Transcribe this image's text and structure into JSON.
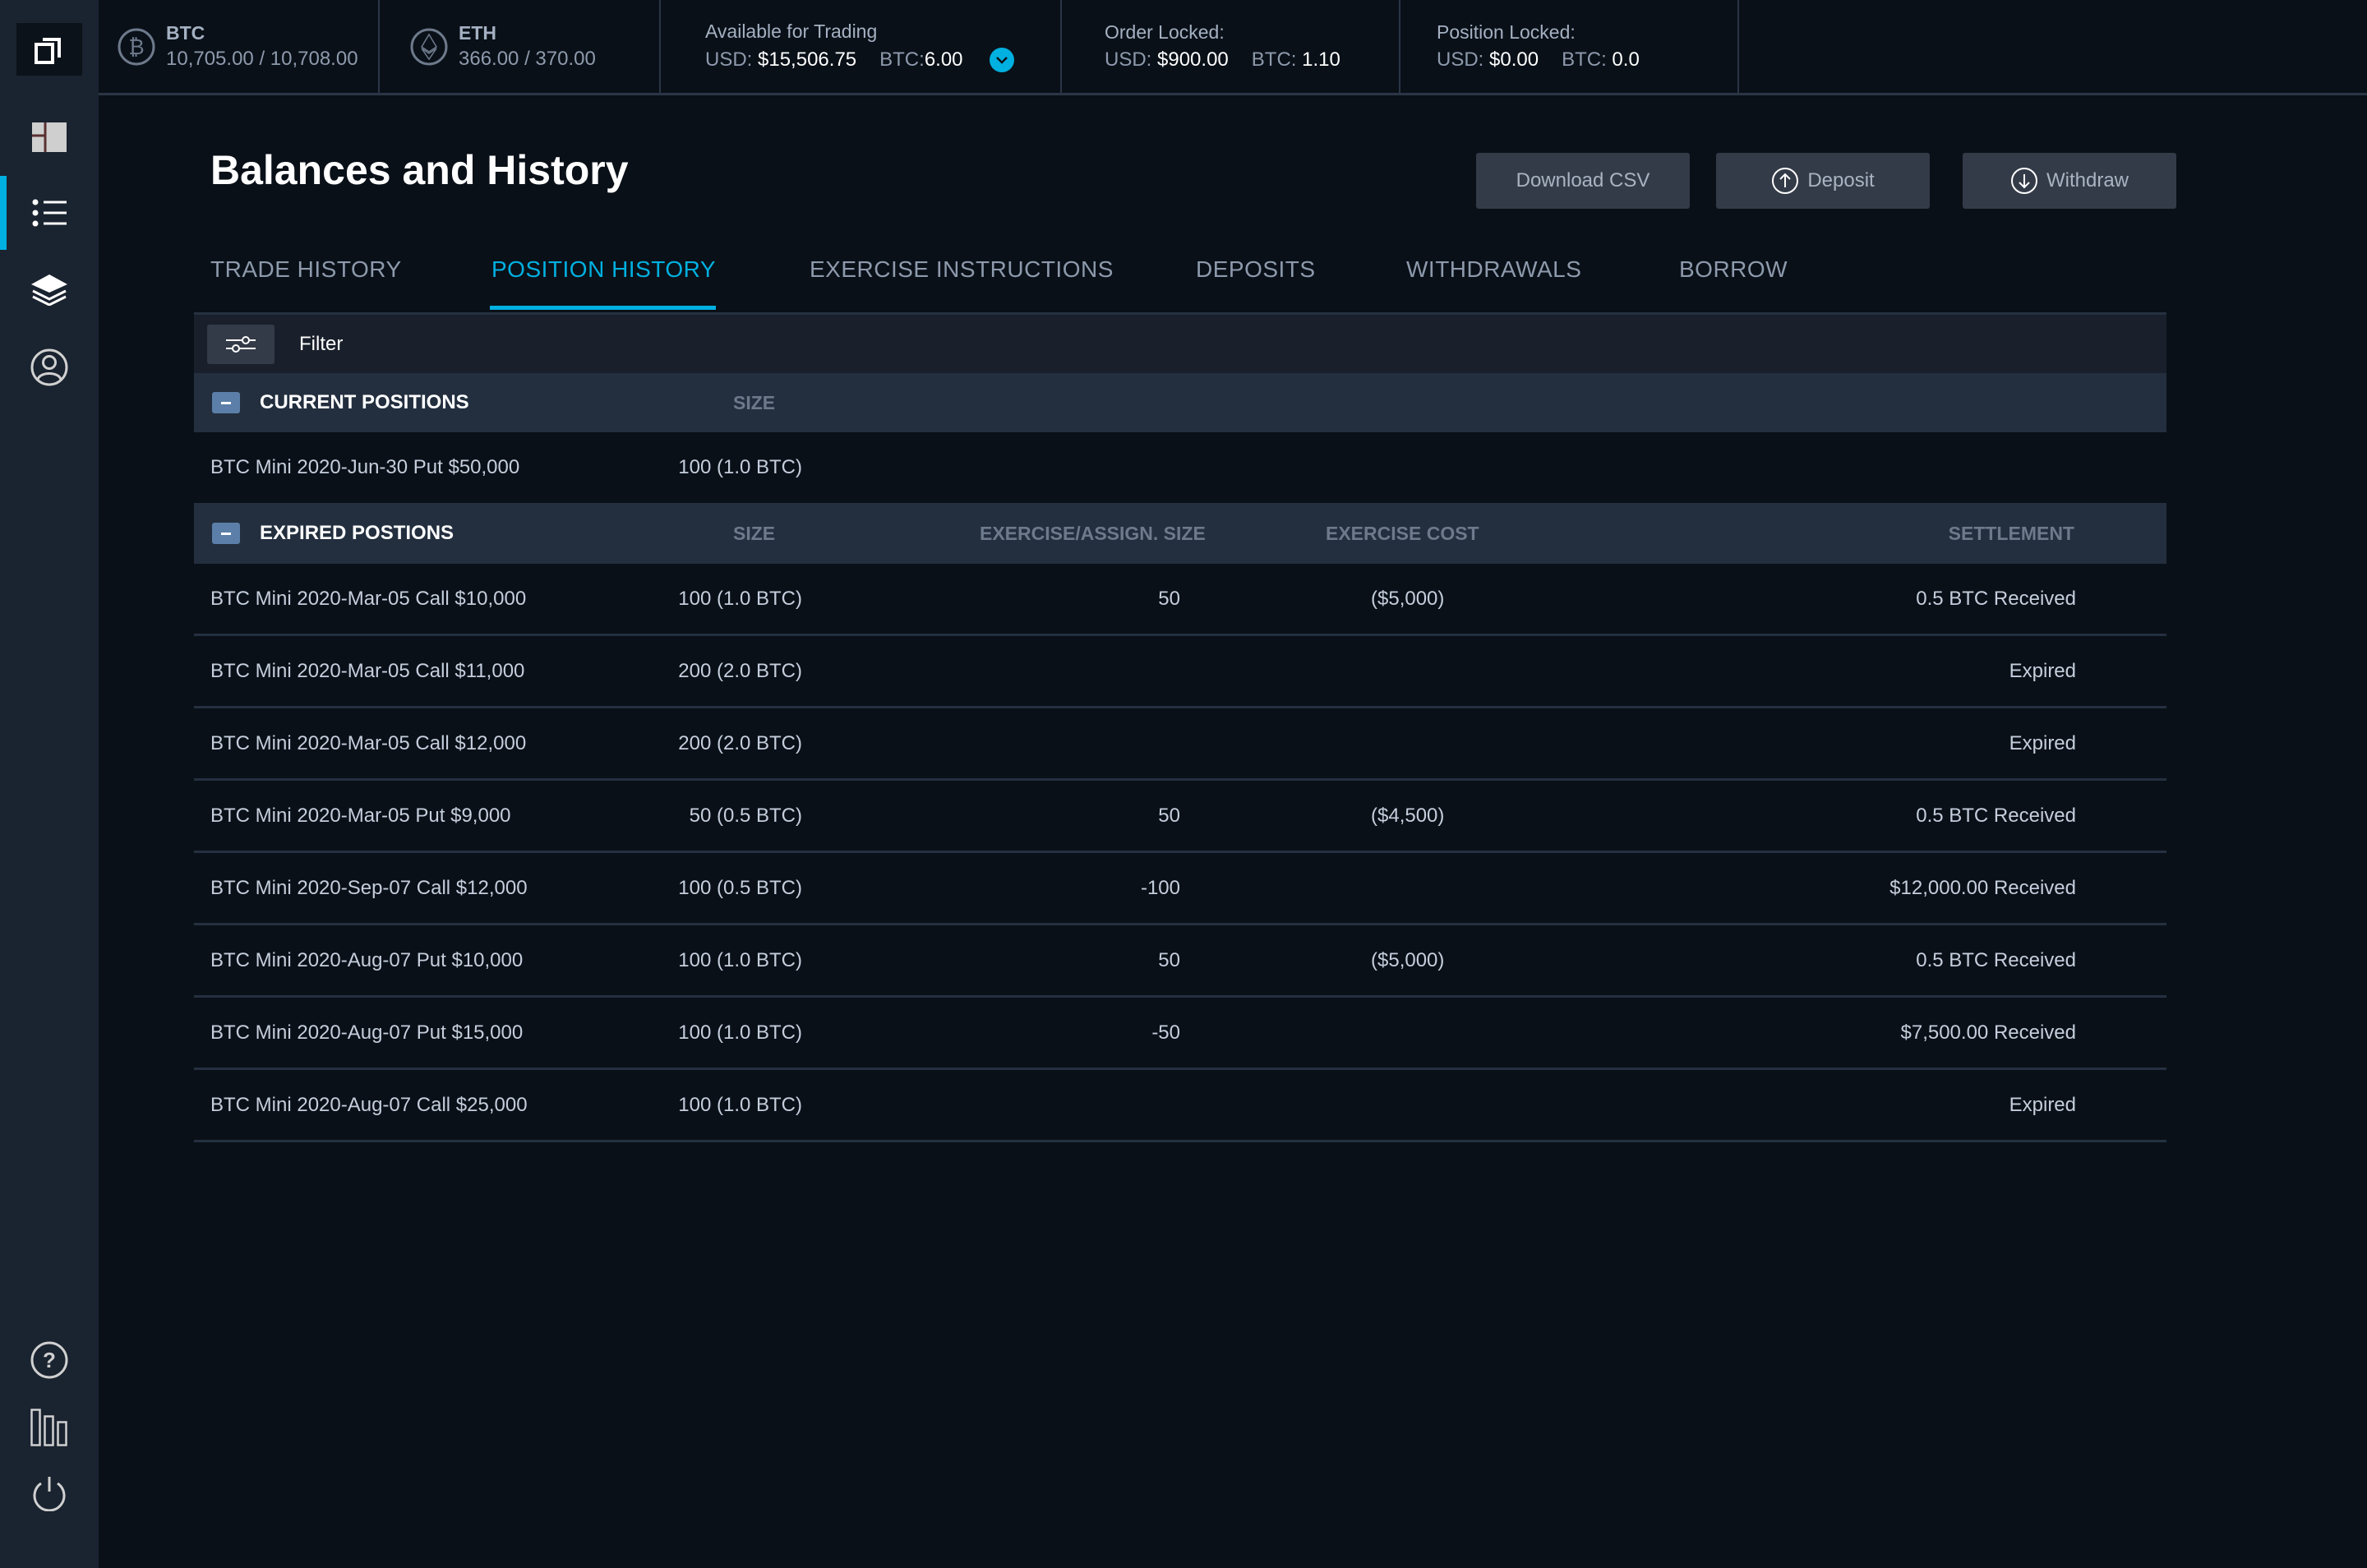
{
  "sidebar": {
    "items": [
      {
        "name": "logo",
        "icon": "copy-windows-icon"
      },
      {
        "name": "dashboard",
        "icon": "dashboard-icon"
      },
      {
        "name": "history",
        "icon": "list-icon",
        "active": true
      },
      {
        "name": "layers",
        "icon": "layers-icon"
      },
      {
        "name": "account",
        "icon": "user-circle-icon"
      },
      {
        "name": "help",
        "icon": "help-icon"
      },
      {
        "name": "stats",
        "icon": "bar-chart-icon"
      },
      {
        "name": "logout",
        "icon": "power-icon"
      }
    ]
  },
  "topbar": {
    "btc": {
      "label": "BTC",
      "value": "10,705.00 / 10,708.00"
    },
    "eth": {
      "label": "ETH",
      "value": "366.00 / 370.00"
    },
    "available": {
      "title": "Available for Trading",
      "usd_key": "USD:",
      "usd_val": "$15,506.75",
      "btc_key": "BTC:",
      "btc_val": "6.00"
    },
    "order_locked": {
      "title": "Order Locked:",
      "usd_key": "USD:",
      "usd_val": "$900.00",
      "btc_key": "BTC:",
      "btc_val": "1.10"
    },
    "position_locked": {
      "title": "Position Locked:",
      "usd_key": "USD:",
      "usd_val": "$0.00",
      "btc_key": "BTC:",
      "btc_val": "0.0"
    }
  },
  "page": {
    "title": "Balances and History",
    "buttons": {
      "download_csv": "Download CSV",
      "deposit": "Deposit",
      "withdraw": "Withdraw"
    }
  },
  "tabs": [
    {
      "label": "TRADE HISTORY"
    },
    {
      "label": "POSITION HISTORY",
      "active": true
    },
    {
      "label": "EXERCISE INSTRUCTIONS"
    },
    {
      "label": "DEPOSITS"
    },
    {
      "label": "WITHDRAWALS"
    },
    {
      "label": "BORROW"
    }
  ],
  "filter": {
    "label": "Filter"
  },
  "current": {
    "title": "CURRENT POSITIONS",
    "columns": {
      "size": "SIZE"
    },
    "rows": [
      {
        "name": "BTC Mini 2020-Jun-30 Put $50,000",
        "size": "100 (1.0 BTC)"
      }
    ]
  },
  "expired": {
    "title": "EXPIRED POSTIONS",
    "columns": {
      "size": "SIZE",
      "exercise": "EXERCISE/ASSIGN. SIZE",
      "cost": "EXERCISE COST",
      "settlement": "SETTLEMENT"
    },
    "rows": [
      {
        "name": "BTC Mini 2020-Mar-05 Call $10,000",
        "size": "100 (1.0 BTC)",
        "exercise": "50",
        "cost": "($5,000)",
        "settlement": "0.5 BTC Received"
      },
      {
        "name": "BTC Mini 2020-Mar-05 Call $11,000",
        "size": "200 (2.0 BTC)",
        "exercise": "",
        "cost": "",
        "settlement": "Expired"
      },
      {
        "name": "BTC Mini 2020-Mar-05 Call $12,000",
        "size": "200 (2.0 BTC)",
        "exercise": "",
        "cost": "",
        "settlement": "Expired"
      },
      {
        "name": "BTC Mini 2020-Mar-05 Put $9,000",
        "size": "50 (0.5 BTC)",
        "exercise": "50",
        "cost": "($4,500)",
        "settlement": "0.5 BTC Received"
      },
      {
        "name": "BTC Mini 2020-Sep-07 Call $12,000",
        "size": "100 (0.5 BTC)",
        "exercise": "-100",
        "cost": "",
        "settlement": "$12,000.00 Received"
      },
      {
        "name": "BTC Mini 2020-Aug-07 Put $10,000",
        "size": "100 (1.0 BTC)",
        "exercise": "50",
        "cost": "($5,000)",
        "settlement": "0.5 BTC Received"
      },
      {
        "name": "BTC Mini 2020-Aug-07 Put $15,000",
        "size": "100 (1.0 BTC)",
        "exercise": "-50",
        "cost": "",
        "settlement": "$7,500.00 Received"
      },
      {
        "name": "BTC Mini 2020-Aug-07 Call $25,000",
        "size": "100 (1.0 BTC)",
        "exercise": "",
        "cost": "",
        "settlement": "Expired"
      }
    ]
  },
  "colors": {
    "accent": "#00b0e0",
    "sidebar_bg": "#1a2330",
    "page_bg": "#0a1018",
    "section_header": "#232f3f"
  }
}
